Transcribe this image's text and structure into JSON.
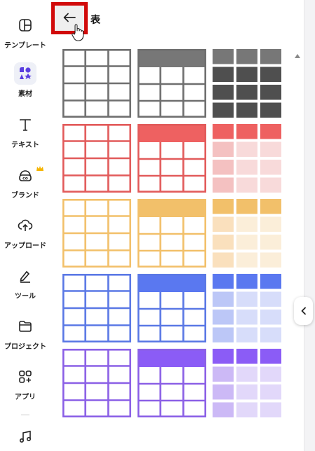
{
  "panel": {
    "title": "表",
    "back_icon": "arrow-left-icon"
  },
  "sidebar": {
    "items": [
      {
        "label": "テンプレート",
        "icon": "template-icon",
        "active": false
      },
      {
        "label": "素材",
        "icon": "elements-icon",
        "active": true
      },
      {
        "label": "テキスト",
        "icon": "text-icon",
        "active": false
      },
      {
        "label": "ブランド",
        "icon": "brand-icon",
        "active": false,
        "badge_icon": "crown-icon"
      },
      {
        "label": "アップロード",
        "icon": "upload-icon",
        "active": false
      },
      {
        "label": "ツール",
        "icon": "pen-icon",
        "active": false
      },
      {
        "label": "プロジェクト",
        "icon": "folder-icon",
        "active": false
      },
      {
        "label": "アプリ",
        "icon": "apps-icon",
        "active": false
      },
      {
        "label": "",
        "icon": "music-icon",
        "active": false
      }
    ]
  },
  "tables": {
    "rows": [
      {
        "color": "gray",
        "border": "#6f6f6f",
        "header_fill": "#777777",
        "solid": "#4f4f4f",
        "header_tint": "#777777"
      },
      {
        "color": "red",
        "border": "#e25b5b",
        "header_fill": "#ee6161",
        "tint1": "#f4c1c1",
        "tint2": "#f8dada"
      },
      {
        "color": "yellow",
        "border": "#f2c06a",
        "header_fill": "#f2c06a",
        "tint1": "#fae0bd",
        "tint2": "#fbeed9"
      },
      {
        "color": "blue",
        "border": "#5a78e5",
        "header_fill": "#5a78f0",
        "tint1": "#bcc7f7",
        "tint2": "#d7ddfa"
      },
      {
        "color": "purple",
        "border": "#8b60e6",
        "header_fill": "#8b5cf6",
        "tint1": "#ccb9f6",
        "tint2": "#e2d8fa"
      }
    ]
  }
}
